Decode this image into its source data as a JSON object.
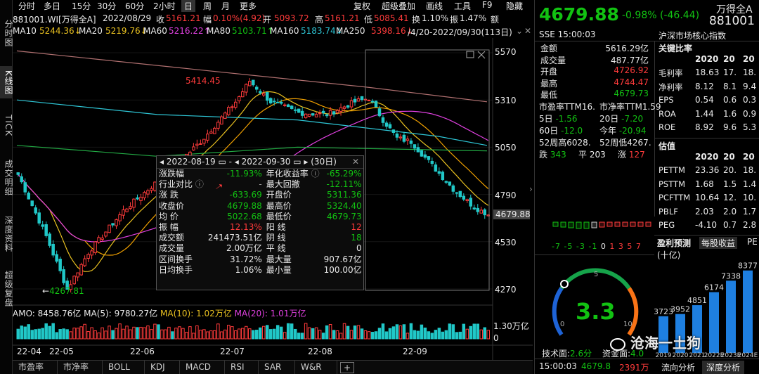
{
  "left_tabs": [
    "分时图",
    "K线图",
    "TICK",
    "成交明细",
    "深度资料",
    "超级复盘"
  ],
  "topbar": {
    "tabs": [
      "分时",
      "多日",
      "15分",
      "30分",
      "60分",
      "2小时",
      "日",
      "周",
      "月",
      "更多"
    ],
    "active_tab": "日",
    "right_buttons": [
      "复权",
      "超级叠加",
      "画线",
      "工具",
      "F9",
      "隐藏"
    ]
  },
  "info_row": {
    "code": "881001.WI[万得全A]",
    "date": "2022/08/29",
    "close_label": "收",
    "close": "5161.21",
    "chg_label": "幅",
    "chg": "0.10%(4.92)",
    "open_label": "开",
    "open": "5093.72",
    "high_label": "高",
    "high": "5161.21",
    "low_label": "低",
    "low": "5085.41",
    "turn_label": "换",
    "turn": "1.10%",
    "amp_label": "振",
    "amp": "1.47%",
    "amt_label": "额"
  },
  "ma_row": {
    "ma10_label": "MA10",
    "ma10": "5244.36↓",
    "ma20_label": "MA20",
    "ma20": "5219.76↓",
    "ma60_label": "MA60",
    "ma60": "5216.22↑",
    "ma80_label": "MA80",
    "ma80": "5103.71↑",
    "ma160_label": "MA160",
    "ma160": "5183.74↓",
    "ma250_label": "MA250",
    "ma250": "5398.16↓",
    "range": "/4/20-2022/09/30(113日)"
  },
  "price_axis": [
    "5570",
    "5310",
    "5050",
    "4790",
    "4530",
    "4270"
  ],
  "current_price_tag": "4679.88",
  "annotations": {
    "high": "5414.45",
    "low": "4267.81"
  },
  "volume": {
    "amo_label": "AMO:",
    "amo": "8458.76亿",
    "ma5_label": "MA(5):",
    "ma5": "9780.27亿",
    "ma10_label": "MA(10):",
    "ma10": "1.02万亿",
    "ma20_label": "MA(20):",
    "ma20": "1.01万亿",
    "axis_top": "1.30万亿",
    "axis_zero": "0"
  },
  "date_axis": [
    "22-04",
    "22-05",
    "22-06",
    "22-07",
    "22-08",
    "22-09"
  ],
  "popup": {
    "start": "2022-08-19",
    "end": "2022-09-30",
    "days": "(30日)",
    "rows": [
      {
        "l1": "涨跌幅",
        "v1": "-11.93%",
        "l2": "年化收益率",
        "v2": "-65.29%",
        "c1": "green",
        "c2": "green"
      },
      {
        "l1": "行业对比",
        "v1": "-",
        "l2": "最大回撤",
        "v2": "-12.11%",
        "c1": "gray",
        "c2": "green"
      },
      {
        "l1": "涨  跌",
        "v1": "-633.69",
        "l2": "开盘价",
        "v2": "5311.36",
        "c1": "green",
        "c2": "green"
      },
      {
        "l1": "收盘价",
        "v1": "4679.88",
        "l2": "最高价",
        "v2": "5324.40",
        "c1": "green",
        "c2": "green"
      },
      {
        "l1": "均  价",
        "v1": "5022.68",
        "l2": "最低价",
        "v2": "4679.73",
        "c1": "green",
        "c2": "green"
      },
      {
        "l1": "振  幅",
        "v1": "12.13%",
        "l2": "阳  线",
        "v2": "12",
        "c1": "red",
        "c2": "red"
      },
      {
        "l1": "成交额",
        "v1": "241473.51亿",
        "l2": "阴  线",
        "v2": "18",
        "c1": "white",
        "c2": "green"
      },
      {
        "l1": "成交量",
        "v1": "2.00万亿",
        "l2": "平  线",
        "v2": "0",
        "c1": "white",
        "c2": "white"
      },
      {
        "l1": "区间换手",
        "v1": "31.72%",
        "l2": "最大量",
        "v2": "907.67亿",
        "c1": "white",
        "c2": "white"
      },
      {
        "l1": "日均换手",
        "v1": "1.06%",
        "l2": "最小量",
        "v2": "100.00亿",
        "c1": "white",
        "c2": "white"
      }
    ]
  },
  "bottom_tabs": [
    "市盈率",
    "市净率",
    "BOLL",
    "KDJ",
    "MACD",
    "RSI",
    "SAR",
    "W&R",
    "+"
  ],
  "right": {
    "price": "4679.88",
    "change_pct": "-0.98%",
    "change": "(-46.44)",
    "name": "万得全A",
    "code": "881001",
    "exchange_time": "SSE 15:00:03",
    "index_desc": "沪深市场核心指数",
    "quotes": [
      {
        "label": "金额",
        "value": "5616.29亿",
        "color": "white"
      },
      {
        "label": "成交量",
        "value": "487.77亿",
        "color": "white"
      },
      {
        "label": "开盘",
        "value": "4726.92",
        "color": "red"
      },
      {
        "label": "最高",
        "value": "4744.47",
        "color": "red"
      },
      {
        "label": "最低",
        "value": "4679.73",
        "color": "green"
      }
    ],
    "pe_label": "市盈率TTM",
    "pe": "16.",
    "pb_label": "市净率TTM",
    "pb": "1.59",
    "d5_label": "5日",
    "d5": "-1.56",
    "d20_label": "20日",
    "d20": "-7.20",
    "d60_label": "60日",
    "d60": "-12.0",
    "ytd_label": "今年",
    "ytd": "-20.94",
    "w52h_label": "52周高",
    "w52h": "6028.",
    "w52l_label": "52周低",
    "w52l": "4267.",
    "down_label": "跌",
    "down": "343",
    "flat_label": "平",
    "flat": "203",
    "up_label": "涨",
    "up": "127",
    "dist_neg": "-7 -5 -3 -1",
    "dist_zero": "0",
    "dist_pos": "1 3 5 7",
    "gauge_value": "3.3",
    "gauge_0": "0",
    "gauge_5": "5",
    "gauge_10": "10",
    "tech_label": "技术面:",
    "tech": "2.6分",
    "fund_label": "资金面:",
    "fund": "4.0",
    "foot_time": "15:00:03",
    "foot_price": "4679.8",
    "foot_vol": "2391万",
    "foot_tabs": [
      "流向分析",
      "深度分析"
    ],
    "ratios_title": "关键比率",
    "ratios_headers": [
      "2020",
      "20",
      "20"
    ],
    "ratios": [
      {
        "label": "毛利率",
        "v": [
          "18.63",
          "17.",
          "18."
        ]
      },
      {
        "label": "净利率",
        "v": [
          "8.12",
          "8.1",
          "9.4"
        ]
      },
      {
        "label": "EPS",
        "v": [
          "0.54",
          "0.6",
          "0.3"
        ]
      },
      {
        "label": "ROA",
        "v": [
          "1.44",
          "1.6",
          "0.9"
        ]
      },
      {
        "label": "ROE",
        "v": [
          "8.92",
          "9.6",
          "5.3"
        ]
      }
    ],
    "val_title": "估值",
    "val_headers": [
      "2020",
      "20",
      "20"
    ],
    "vals": [
      {
        "label": "PETTM",
        "v": [
          "23.36",
          "20.",
          "18."
        ]
      },
      {
        "label": "PSTTM",
        "v": [
          "1.68",
          "1.5",
          "1.4"
        ]
      },
      {
        "label": "PCFTTM",
        "v": [
          "10.64",
          "12.",
          "10."
        ]
      },
      {
        "label": "PBLF",
        "v": [
          "2.03",
          "2.0",
          "1.7"
        ]
      },
      {
        "label": "PEG",
        "v": [
          "-4.10",
          "0.7",
          "2.8"
        ]
      }
    ],
    "forecast_tabs": [
      "盈利预测",
      "每股收益",
      "PE"
    ],
    "forecast_unit": "(十亿)",
    "forecast_values": [
      3723,
      3952,
      4851,
      6174,
      7338,
      8377
    ],
    "forecast_years": [
      "2019",
      "2020",
      "2021",
      "2022E",
      "2023E",
      "2024E"
    ]
  },
  "watermark": "沧海一土狗",
  "colors": {
    "up": "#ff3b3b",
    "down": "#12c212",
    "bg": "#000000"
  }
}
